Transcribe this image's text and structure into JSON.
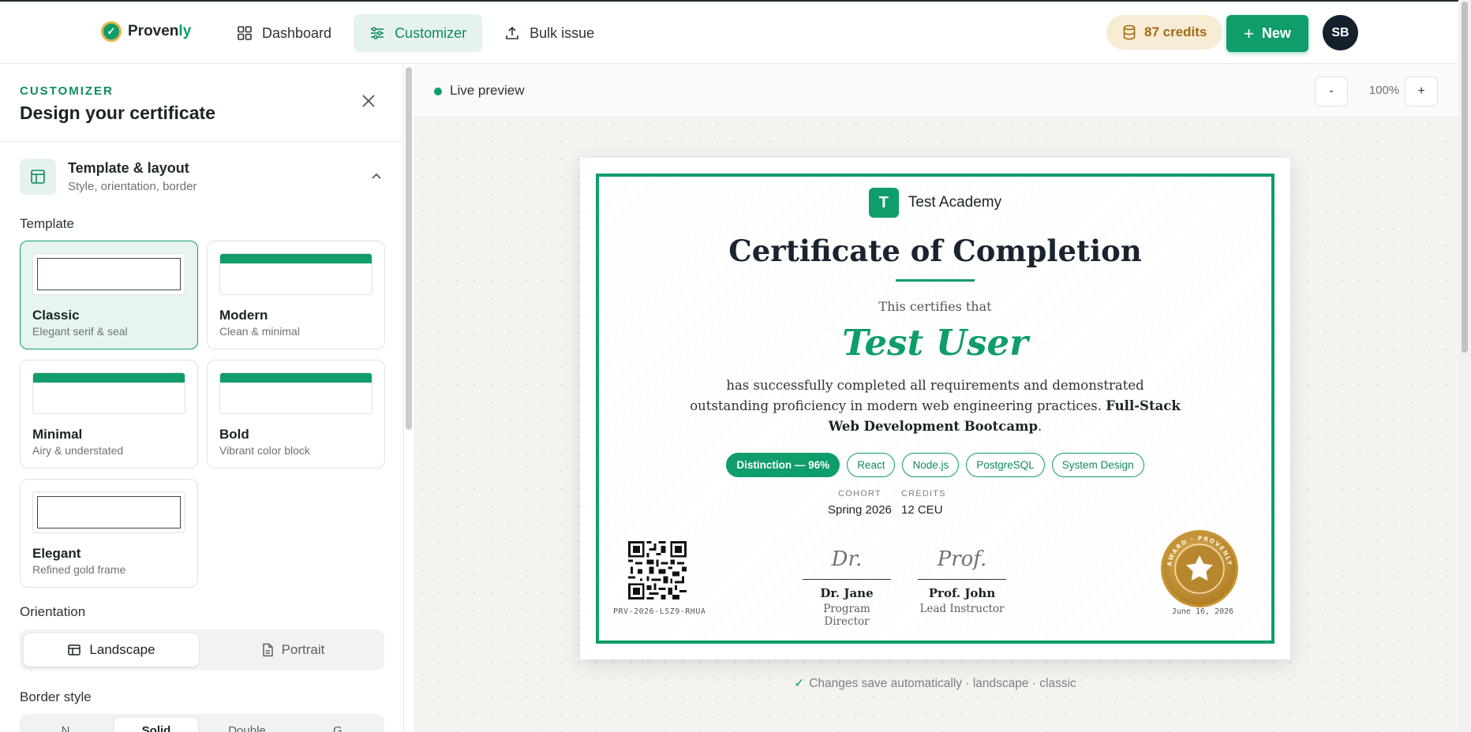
{
  "app": {
    "brand_prefix": "Proven",
    "brand_suffix": "ly",
    "nav": [
      {
        "label": "Dashboard",
        "icon": "grid-icon",
        "active": false
      },
      {
        "label": "Customizer",
        "icon": "sliders-icon",
        "active": true
      },
      {
        "label": "Bulk issue",
        "icon": "upload-icon",
        "active": false
      }
    ],
    "credits": "87 credits",
    "new_label": "New",
    "avatar_initials": "SB"
  },
  "sidebar": {
    "eyebrow": "CUSTOMIZER",
    "title": "Design your certificate",
    "section": {
      "title": "Template & layout",
      "subtitle": "Style, orientation, border"
    },
    "template_label": "Template",
    "templates": [
      {
        "name": "Classic",
        "desc": "Elegant serif & seal",
        "selected": true
      },
      {
        "name": "Modern",
        "desc": "Clean & minimal",
        "selected": false
      },
      {
        "name": "Minimal",
        "desc": "Airy & understated",
        "selected": false
      },
      {
        "name": "Bold",
        "desc": "Vibrant color block",
        "selected": false
      },
      {
        "name": "Elegant",
        "desc": "Refined gold frame",
        "selected": false
      }
    ],
    "orientation_label": "Orientation",
    "orientation": {
      "landscape": "Landscape",
      "portrait": "Portrait",
      "selected": "Landscape"
    },
    "border_label": "Border style",
    "border_options": [
      "N",
      "Solid",
      "Double",
      "G"
    ]
  },
  "preview": {
    "live_label": "Live preview",
    "zoom_minus": "-",
    "zoom": "100%",
    "zoom_plus": "+",
    "save_note": "Changes save automatically · landscape · classic"
  },
  "certificate": {
    "org_initial": "T",
    "org_name": "Test Academy",
    "title": "Certificate of Completion",
    "certifies": "This certifies that",
    "recipient": "Test User",
    "body_1": "has successfully completed all requirements and demonstrated outstanding proficiency in modern web engineering practices. ",
    "body_course": "Full-Stack Web Development Bootcamp",
    "body_end": ".",
    "chips": [
      "Distinction — 96%",
      "React",
      "Node.js",
      "PostgreSQL",
      "System Design"
    ],
    "cohort_label": "COHORT",
    "cohort": "Spring 2026",
    "credits_label": "CREDITS",
    "credits": "12 CEU",
    "serial": "PRV-2026-LSZ9-RHUA",
    "signers": [
      {
        "script": "Dr.",
        "name": "Dr. Jane",
        "role": "Program Director"
      },
      {
        "script": "Prof.",
        "name": "Prof. John",
        "role": "Lead Instructor"
      }
    ],
    "seal_text": "AWARD · PROVENLY",
    "date": "June 16, 2026"
  },
  "colors": {
    "brand_green": "#0f9d6a",
    "gold": "#c99532",
    "credits_bg": "#f8ecd5",
    "avatar_bg": "#14202c"
  }
}
